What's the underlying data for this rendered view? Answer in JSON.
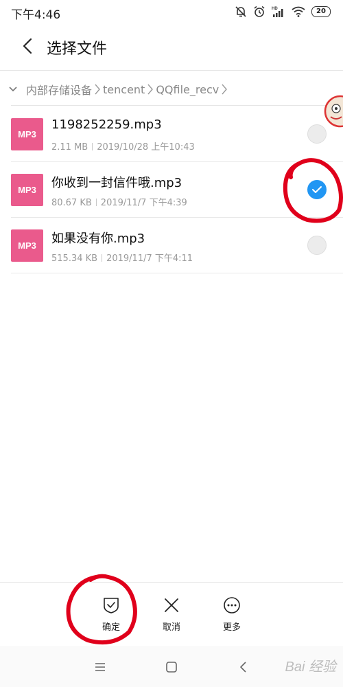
{
  "status_bar": {
    "time": "下午4:46",
    "battery": "20",
    "icons": [
      "mute-icon",
      "alarm-icon",
      "hd-signal-icon",
      "wifi-icon",
      "battery-icon"
    ]
  },
  "header": {
    "title": "选择文件"
  },
  "breadcrumb": [
    "内部存储设备",
    "tencent",
    "QQfile_recv"
  ],
  "files": [
    {
      "badge": "MP3",
      "name": "1198252259.mp3",
      "size": "2.11 MB",
      "date": "2019/10/28 上午10:43",
      "selected": false
    },
    {
      "badge": "MP3",
      "name": "你收到一封信件哦.mp3",
      "size": "80.67 KB",
      "date": "2019/11/7 下午4:39",
      "selected": true
    },
    {
      "badge": "MP3",
      "name": "如果没有你.mp3",
      "size": "515.34 KB",
      "date": "2019/11/7 下午4:11",
      "selected": false
    }
  ],
  "actions": {
    "confirm": "确定",
    "cancel": "取消",
    "more": "更多"
  },
  "watermark": "Bai 经验",
  "colors": {
    "badge": "#ea5a8c",
    "selected": "#2196f3",
    "annotation": "#e0001b"
  }
}
